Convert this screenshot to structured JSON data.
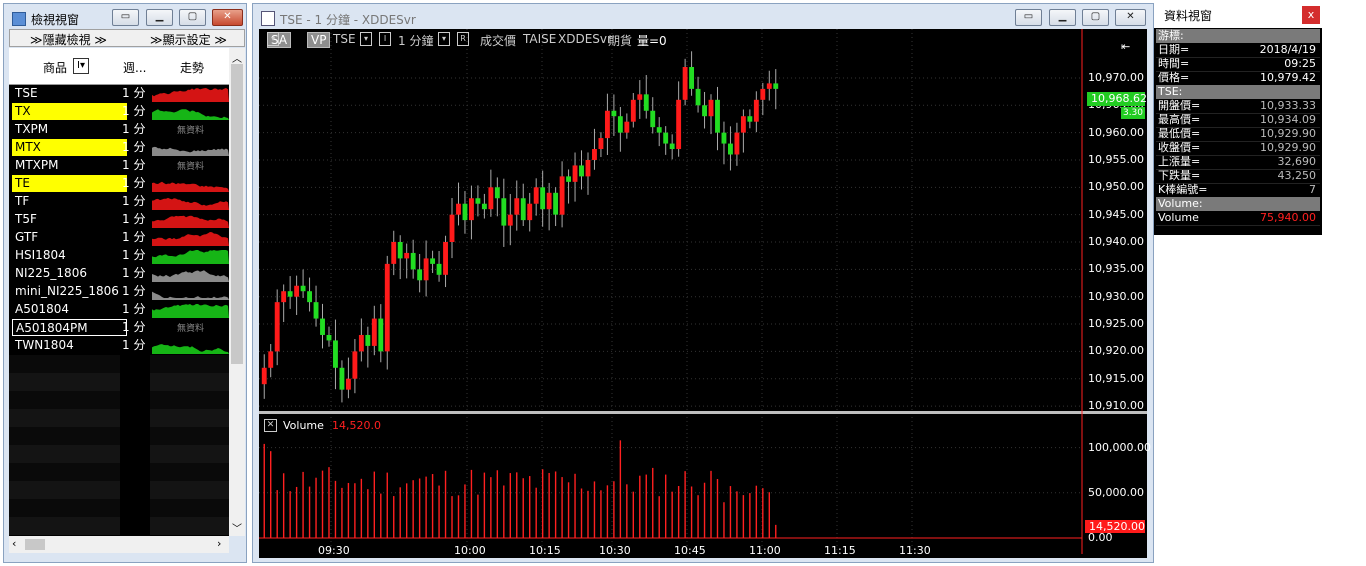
{
  "watch_window": {
    "title": "檢視視窗",
    "hide_view_label": "≫隱藏檢視 ≫",
    "display_settings_label": "≫顯示設定 ≫",
    "col_symbol": "商品",
    "col_period": "週...",
    "col_trend": "走勢",
    "no_data_text": "無資料",
    "rows": [
      {
        "symbol": "TSE",
        "period": "1 分",
        "highlight": false,
        "selected": false,
        "trend": "red"
      },
      {
        "symbol": "TX",
        "period": "1 分",
        "highlight": true,
        "selected": false,
        "trend": "green"
      },
      {
        "symbol": "TXPM",
        "period": "1 分",
        "highlight": false,
        "selected": false,
        "trend": "none"
      },
      {
        "symbol": "MTX",
        "period": "1 分",
        "highlight": true,
        "selected": false,
        "trend": "gray"
      },
      {
        "symbol": "MTXPM",
        "period": "1 分",
        "highlight": false,
        "selected": false,
        "trend": "none"
      },
      {
        "symbol": "TE",
        "period": "1 分",
        "highlight": true,
        "selected": false,
        "trend": "red"
      },
      {
        "symbol": "TF",
        "period": "1 分",
        "highlight": false,
        "selected": false,
        "trend": "red"
      },
      {
        "symbol": "T5F",
        "period": "1 分",
        "highlight": false,
        "selected": false,
        "trend": "red"
      },
      {
        "symbol": "GTF",
        "period": "1 分",
        "highlight": false,
        "selected": false,
        "trend": "red"
      },
      {
        "symbol": "HSI1804",
        "period": "1 分",
        "highlight": false,
        "selected": false,
        "trend": "green"
      },
      {
        "symbol": "NI225_1806",
        "period": "1 分",
        "highlight": false,
        "selected": false,
        "trend": "gray"
      },
      {
        "symbol": "mini_NI225_1806",
        "period": "1 分",
        "highlight": false,
        "selected": false,
        "trend": "gray"
      },
      {
        "symbol": "A501804",
        "period": "1 分",
        "highlight": false,
        "selected": false,
        "trend": "green"
      },
      {
        "symbol": "A501804PM",
        "period": "1 分",
        "highlight": false,
        "selected": true,
        "trend": "none"
      },
      {
        "symbol": "TWN1804",
        "period": "1 分",
        "highlight": false,
        "selected": false,
        "trend": "green"
      }
    ]
  },
  "chart_window": {
    "title": "TSE - 1 分鐘 - XDDESvr",
    "toolbar": {
      "sa": "SA",
      "vp": "VP",
      "symbol": "TSE",
      "interval": "1 分鐘",
      "field": "成交價",
      "exchange": "TAISE",
      "server": "XDDESvr",
      "category": "期貨",
      "volume_label": "量=0"
    },
    "price_label": "10,968.62",
    "price_sub_label": "3.30",
    "volume_title": "Volume",
    "volume_value": "14,520.0",
    "volume_price_label": "14,520.00",
    "colors": {
      "up": "#ff1a1a",
      "down": "#22dd22",
      "volume": "#ff2020",
      "axis": "#ff2020"
    }
  },
  "chart_data": [
    {
      "type": "candlestick",
      "title": "TSE - 1 分鐘",
      "x_ticks": [
        "09:30",
        "10:00",
        "10:15",
        "10:30",
        "10:45",
        "11:00",
        "11:15",
        "11:30"
      ],
      "y_ticks": [
        "10,970.00",
        "10,965.00",
        "10,960.00",
        "10,955.00",
        "10,950.00",
        "10,945.00",
        "10,940.00",
        "10,935.00",
        "10,930.00",
        "10,925.00",
        "10,920.00",
        "10,915.00",
        "10,910.00"
      ],
      "ylim": [
        10908,
        10972
      ],
      "series": [
        {
          "name": "TSE",
          "last": 10968.62
        }
      ]
    },
    {
      "type": "bar",
      "title": "Volume",
      "y_ticks": [
        "100,000.00",
        "50,000.00",
        "0.00"
      ],
      "ylim": [
        0,
        115000
      ],
      "last_value": 14520.0
    }
  ],
  "info_window": {
    "title": "資料視窗",
    "close": "x",
    "rows": [
      {
        "k": "游標:",
        "v": "",
        "type": "section"
      },
      {
        "k": "日期=",
        "v": "2018/4/19",
        "type": "plain"
      },
      {
        "k": "時間=",
        "v": "09:25",
        "type": "plain"
      },
      {
        "k": "價格=",
        "v": "10,979.42",
        "type": "plain"
      },
      {
        "k": "TSE:",
        "v": "",
        "type": "section"
      },
      {
        "k": "開盤價=",
        "v": "10,933.33",
        "type": "dim"
      },
      {
        "k": "最高價=",
        "v": "10,934.09",
        "type": "dim"
      },
      {
        "k": "最低價=",
        "v": "10,929.90",
        "type": "dim"
      },
      {
        "k": "收盤價=",
        "v": "10,929.90",
        "type": "dim"
      },
      {
        "k": "上漲量=",
        "v": "32,690",
        "type": "dim"
      },
      {
        "k": "下跌量=",
        "v": "43,250",
        "type": "dim"
      },
      {
        "k": "K棒編號=",
        "v": "7",
        "type": "dim"
      },
      {
        "k": "Volume:",
        "v": "",
        "type": "section"
      },
      {
        "k": "Volume",
        "v": "75,940.00",
        "type": "red"
      }
    ]
  }
}
